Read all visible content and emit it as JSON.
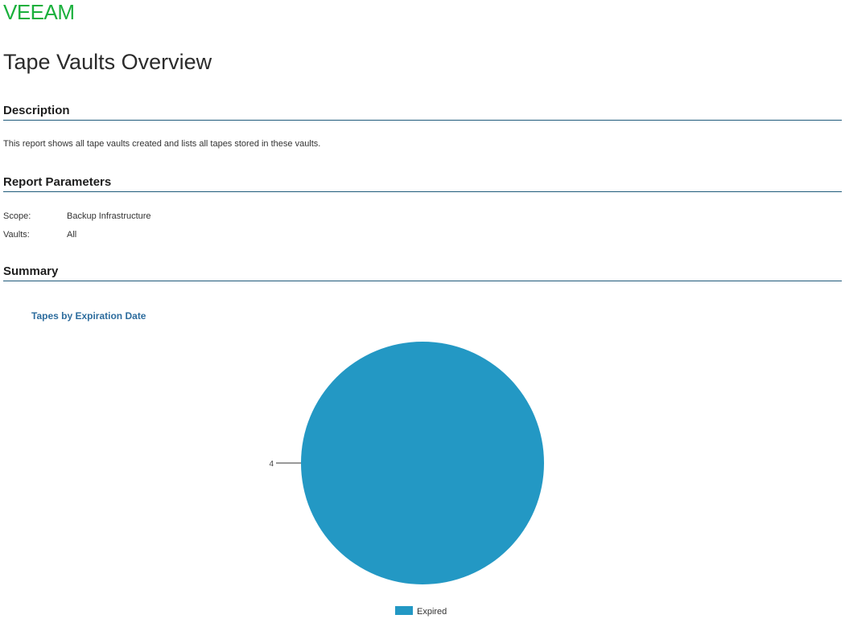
{
  "logo": {
    "text": "VEEAM",
    "color": "#1ab03c"
  },
  "report": {
    "title": "Tape Vaults Overview"
  },
  "sections": {
    "description": {
      "heading": "Description",
      "text": "This report shows all tape vaults created and lists all tapes stored in these vaults."
    },
    "parameters": {
      "heading": "Report Parameters",
      "rows": [
        {
          "label": "Scope:",
          "value": "Backup Infrastructure"
        },
        {
          "label": "Vaults:",
          "value": "All"
        }
      ]
    },
    "summary": {
      "heading": "Summary"
    }
  },
  "chart_data": {
    "type": "pie",
    "title": "Tapes by Expiration Date",
    "slices": [
      {
        "label": "Expired",
        "value": 4,
        "color": "#2398c4"
      }
    ],
    "data_labels": [
      "4"
    ],
    "legend": {
      "position": "bottom",
      "entries": [
        "Expired"
      ]
    }
  },
  "colors": {
    "accent_rule": "#1f5a7a",
    "chart_title": "#2e6d9e"
  }
}
